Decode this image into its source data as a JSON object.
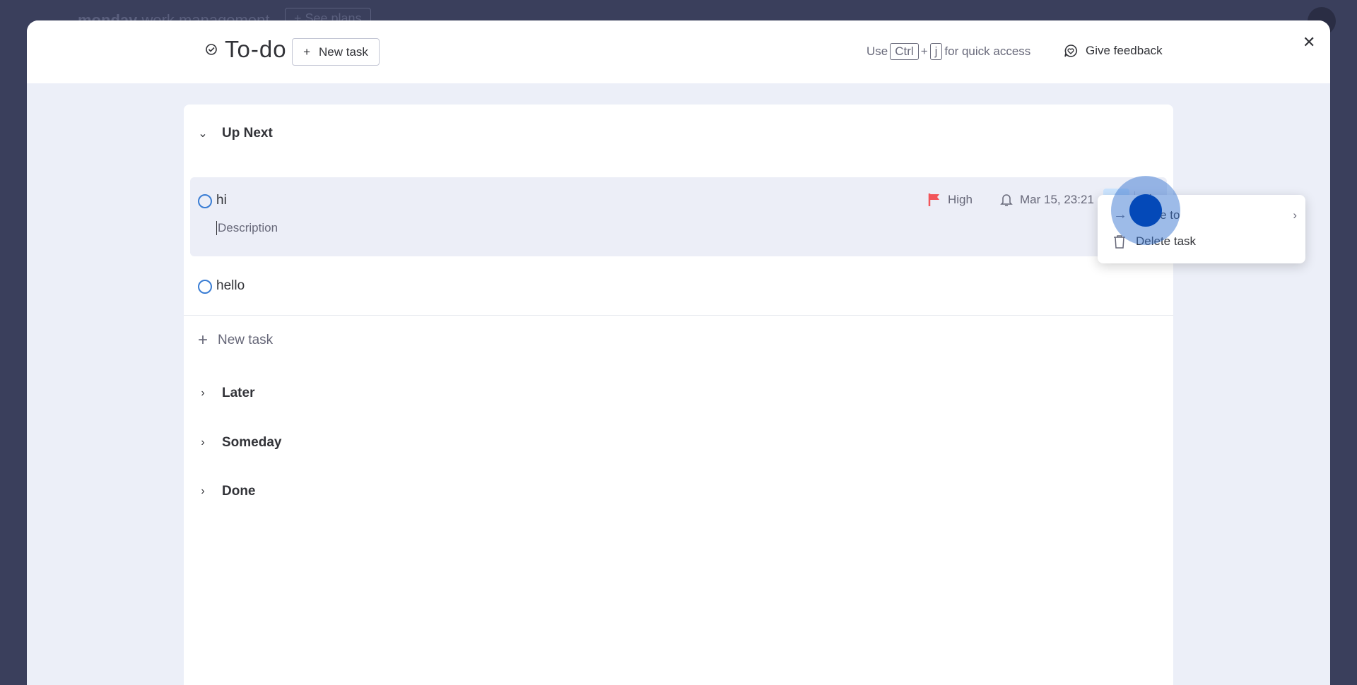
{
  "background": {
    "app_name": "monday",
    "app_suffix": " work management",
    "see_plans": "+ See plans"
  },
  "header": {
    "title": "To-do",
    "new_task": "New task",
    "quick_use": "Use",
    "quick_key1": "Ctrl",
    "quick_plus": "+",
    "quick_key2": "j",
    "quick_suffix": "for quick access",
    "feedback": "Give feedback"
  },
  "sections": {
    "up_next": "Up Next",
    "later": "Later",
    "someday": "Someday",
    "done": "Done"
  },
  "tasks": [
    {
      "name": "hi",
      "description_placeholder": "Description",
      "priority": "High",
      "reminder": "Mar 15, 23:21"
    },
    {
      "name": "hello"
    }
  ],
  "add_task": "New task",
  "menu": {
    "move_to": "Move to",
    "delete": "Delete task"
  },
  "colors": {
    "accent": "#0073ea",
    "priority_high": "#f2555a",
    "overlay": "#3a3f5c"
  }
}
